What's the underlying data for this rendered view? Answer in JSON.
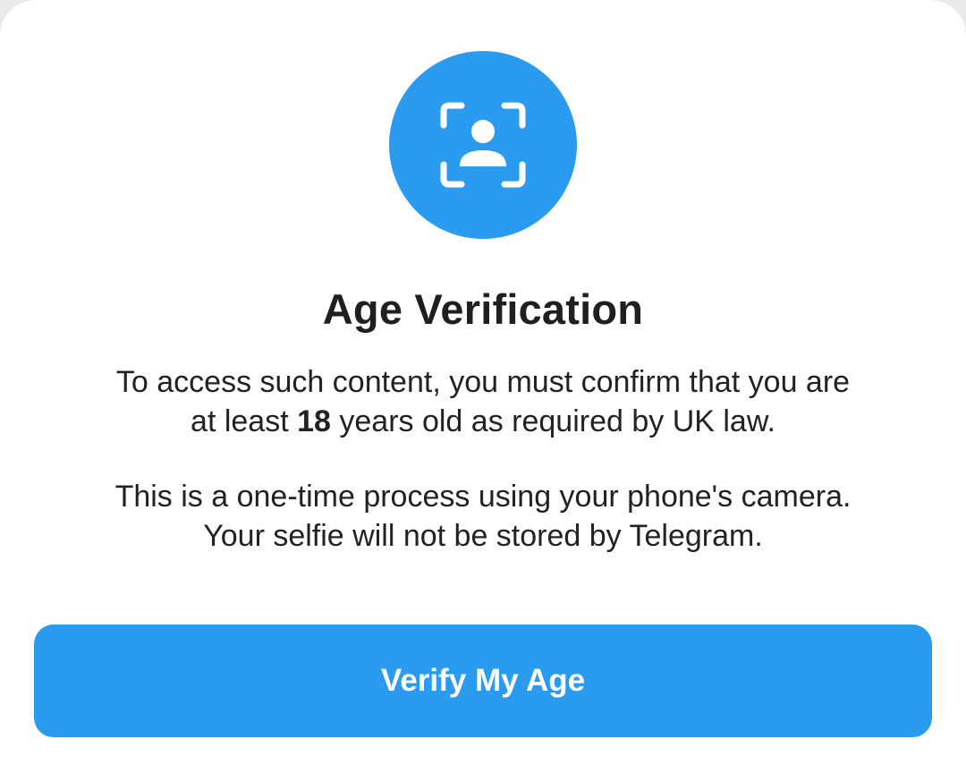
{
  "theme": {
    "accent": "#2a9bef",
    "text": "#1e1f21",
    "background": "#ffffff"
  },
  "header": {
    "icon": "face-scan-icon",
    "title": "Age Verification"
  },
  "body": {
    "paragraph1": {
      "line1": "To access such content, you must confirm that you are",
      "line2_before": "at least ",
      "line2_bold": "18",
      "line2_after": " years old as required by UK law."
    },
    "paragraph2": {
      "line1": "This is a one-time process using your phone's camera.",
      "line2": "Your selfie will not be stored by Telegram."
    }
  },
  "actions": {
    "verify_label": "Verify My Age"
  }
}
